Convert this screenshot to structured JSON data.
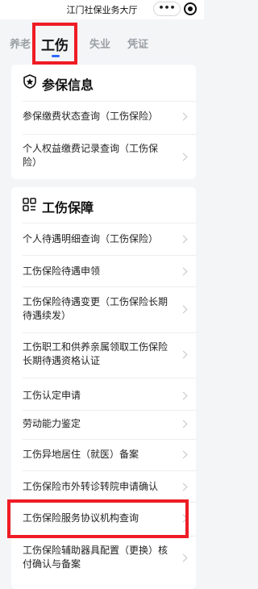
{
  "header": {
    "title": "江门社保业务大厅",
    "more_label": "•••"
  },
  "tabs": [
    {
      "label": "养老"
    },
    {
      "label": "工伤"
    },
    {
      "label": "失业"
    },
    {
      "label": "凭证"
    }
  ],
  "card1": {
    "title": "参保信息",
    "icon": "shield-icon",
    "items": [
      "参保缴费状态查询（工伤保险）",
      "个人权益缴费记录查询（工伤保险）"
    ]
  },
  "card2": {
    "title": "工伤保障",
    "icon": "grid-icon",
    "items": [
      "个人待遇明细查询（工伤保险）",
      "工伤保险待遇申领",
      "工伤保险待遇变更（工伤保险长期待遇续发）",
      "工伤职工和供养亲属领取工伤保险长期待遇资格认证",
      "工伤认定申请",
      "劳动能力鉴定",
      "工伤异地居住（就医）备案",
      "工伤保险市外转诊转院申请确认",
      "工伤保险服务协议机构查询",
      "工伤保险辅助器具配置（更换）核付确认与备案"
    ]
  },
  "colors": {
    "highlight": "#ee1c24",
    "accent": "#2f6bff"
  }
}
